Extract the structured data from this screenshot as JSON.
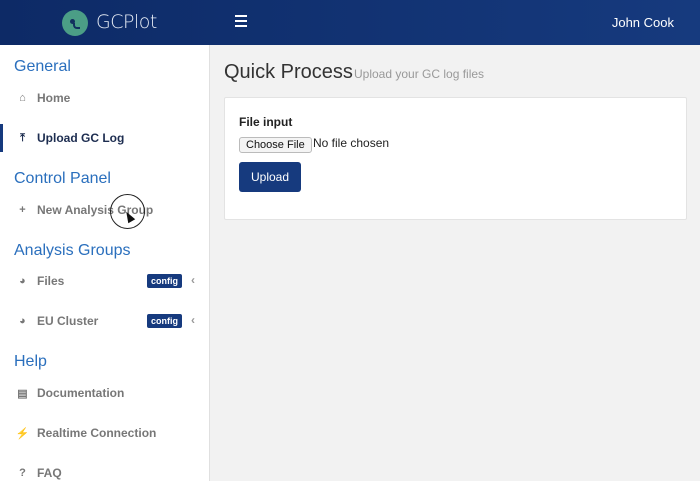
{
  "header": {
    "brand": "GCPlot",
    "user": "John Cook"
  },
  "sidebar": {
    "sections": [
      {
        "title": "General"
      },
      {
        "title": "Control Panel"
      },
      {
        "title": "Analysis Groups"
      },
      {
        "title": "Help"
      }
    ],
    "items": [
      {
        "label": "Home",
        "icon": "home-icon"
      },
      {
        "label": "Upload GC Log",
        "icon": "upload-icon",
        "active": true
      },
      {
        "label": "New Analysis Group",
        "icon": "plus-icon"
      },
      {
        "label": "Files",
        "icon": "pie-chart-icon",
        "badge": "config"
      },
      {
        "label": "EU Cluster",
        "icon": "pie-chart-icon",
        "badge": "config"
      },
      {
        "label": "Documentation",
        "icon": "book-icon"
      },
      {
        "label": "Realtime Connection",
        "icon": "plug-icon"
      },
      {
        "label": "FAQ",
        "icon": "question-icon"
      }
    ]
  },
  "main": {
    "title": "Quick Process",
    "subtitle": "Upload your GC log files",
    "file_label": "File input",
    "choose_button": "Choose File",
    "file_status": "No file chosen",
    "upload_button": "Upload"
  }
}
